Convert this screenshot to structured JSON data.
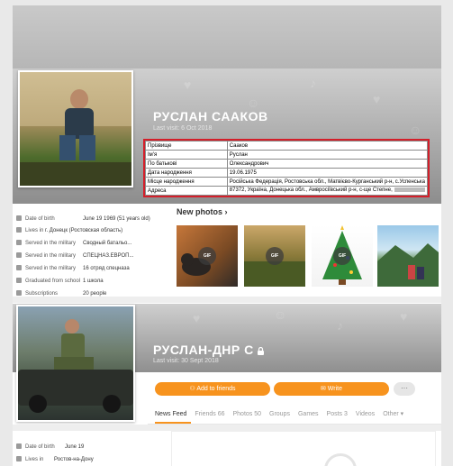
{
  "profile1": {
    "name": "РУСЛАН СААКОВ",
    "last_visit": "Last visit: 6 Oct 2018",
    "info_table": [
      {
        "key": "Прізвище",
        "value": "Сааков"
      },
      {
        "key": "Ім'я",
        "value": "Руслан"
      },
      {
        "key": "По батькові",
        "value": "Олександрович"
      },
      {
        "key": "Дата народження",
        "value": "19.06.1975"
      },
      {
        "key": "Місце народження",
        "value": "Російська Федерація, Ростовська обл., Матвієво-Курганський р-н, с.Успенська"
      },
      {
        "key": "Адреса",
        "value": "87372, Україна, Донецька обл., Амвросіївський р-н, с-ще Степне,"
      }
    ],
    "details": [
      {
        "icon": "calendar-icon",
        "label": "Date of birth",
        "value": "June 19 1969 (51 years old)"
      },
      {
        "icon": "home-icon",
        "label": "Lives in",
        "value": "г. Донецк (Ростовская область)"
      },
      {
        "icon": "military-icon",
        "label": "Served in the military",
        "value": "Сводный батальо..."
      },
      {
        "icon": "military-icon",
        "label": "Served in the military",
        "value": "СПЕЦНАЗ.ЕВРОП..."
      },
      {
        "icon": "military-icon",
        "label": "Served in the military",
        "value": "16 отряд спецназа"
      },
      {
        "icon": "graduation-icon",
        "label": "Graduated from school",
        "value": "1 школа"
      },
      {
        "icon": "subscriptions-icon",
        "label": "Subscriptions",
        "value": "20 people"
      }
    ],
    "new_photos_title": "New photos",
    "photos": [
      {
        "gif_label": "GIF"
      },
      {
        "gif_label": "GIF"
      },
      {
        "gif_label": "GIF"
      },
      {
        "gif_label": ""
      }
    ]
  },
  "profile2": {
    "name": "РУСЛАН-ДНР С",
    "last_visit": "Last visit: 30 Sept 2018",
    "buttons": {
      "add_friends": "Add to friends",
      "write": "Write",
      "more": "···"
    },
    "tabs": [
      "News Feed",
      "Friends 66",
      "Photos 50",
      "Groups",
      "Games",
      "Posts 3",
      "Videos",
      "Other ▾"
    ],
    "details": [
      {
        "icon": "calendar-icon",
        "label": "Date of birth",
        "value": "June 19"
      },
      {
        "icon": "home-icon",
        "label": "Lives in",
        "value": "Ростов-на-Дону"
      }
    ]
  },
  "colors": {
    "accent": "#f7931e",
    "highlight_border": "#d41f2a"
  }
}
